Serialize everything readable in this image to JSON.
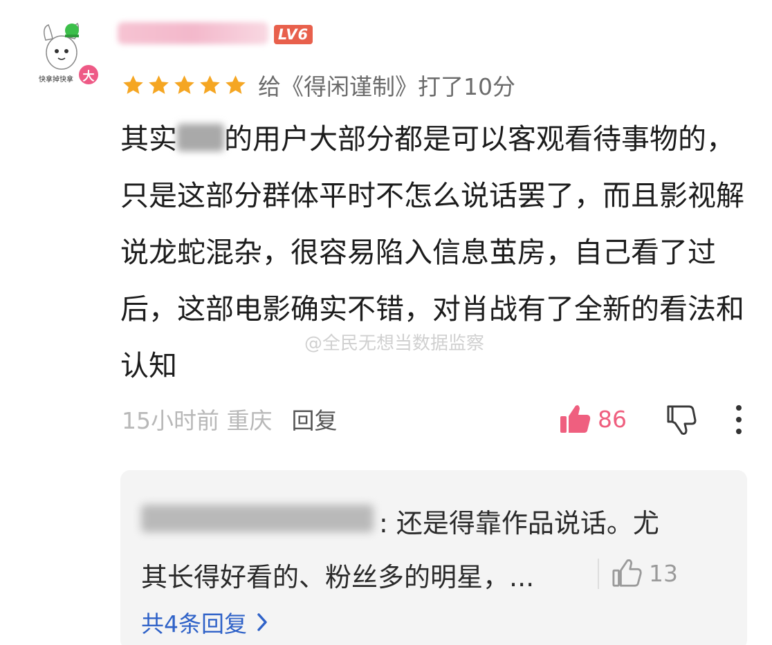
{
  "comment": {
    "user": {
      "level": "LV6",
      "avatar_caption": "快拿掉快拿",
      "avatar_badge": "大"
    },
    "rating": {
      "stars": 5,
      "text": "给《得闲谨制》打了10分"
    },
    "body": {
      "part1": "其实",
      "part2": "的用户大部分都是可以客观看待事物的，只是这部分群体平时不怎么说话罢了，而且影视解说龙蛇混杂，很容易陷入信息茧房，自己看了过后，这部电影确实不错，对肖战有了全新的看法和认知"
    },
    "watermark": "@全民无想当数据监察",
    "meta": {
      "time_location": "15小时前 重庆",
      "reply_label": "回复"
    },
    "likes": "86",
    "colors": {
      "star": "#f5a623",
      "like": "#ef5f7f",
      "level_badge": "#e8604c",
      "link": "#2f62c8"
    }
  },
  "reply_preview": {
    "text_line1": ": 还是得靠作品说话。尤",
    "text_line2": "其长得好看的、粉丝多的明星，...",
    "likes": "13",
    "more_replies": "共4条回复"
  }
}
